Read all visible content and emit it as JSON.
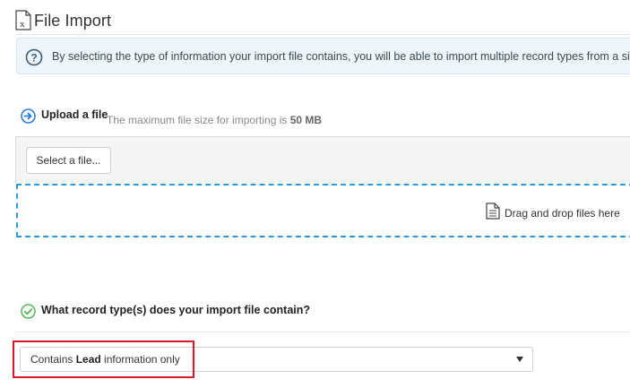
{
  "page": {
    "title": "File Import"
  },
  "info": {
    "text": "By selecting the type of information your import file contains, you will be able to import multiple record types from a single"
  },
  "upload": {
    "label": "Upload a file",
    "note_prefix": "The maximum file size for importing is ",
    "note_value": "50 MB",
    "select_button": "Select a file...",
    "dropzone_text": "Drag and drop files here"
  },
  "record_type": {
    "question": "What record type(s) does your import file contain?",
    "select_prefix": "Contains ",
    "select_bold": "Lead",
    "select_suffix": " information only"
  },
  "colors": {
    "accent_blue": "#2b9ad9",
    "check_green": "#5cb85c",
    "highlight_red": "#d7192a",
    "info_bg": "#eef5fb"
  },
  "icons": [
    "excel-file-icon",
    "question-circle-icon",
    "arrow-right-circle-icon",
    "document-icon",
    "check-circle-icon",
    "caret-down-icon"
  ]
}
